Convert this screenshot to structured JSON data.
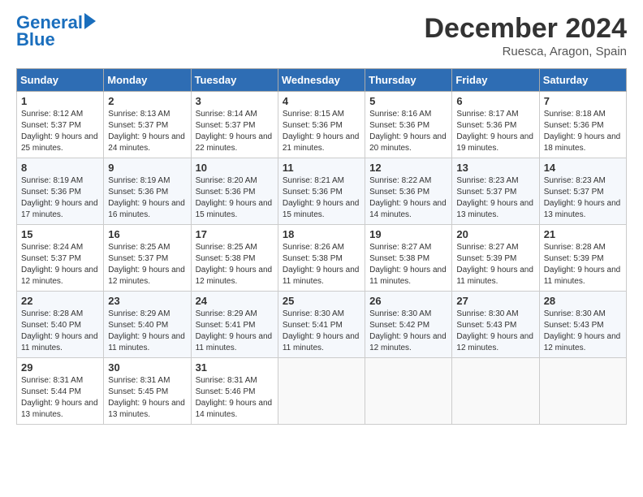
{
  "header": {
    "logo_line1": "General",
    "logo_line2": "Blue",
    "month": "December 2024",
    "location": "Ruesca, Aragon, Spain"
  },
  "weekdays": [
    "Sunday",
    "Monday",
    "Tuesday",
    "Wednesday",
    "Thursday",
    "Friday",
    "Saturday"
  ],
  "weeks": [
    [
      {
        "day": "1",
        "sunrise": "8:12 AM",
        "sunset": "5:37 PM",
        "daylight": "9 hours and 25 minutes."
      },
      {
        "day": "2",
        "sunrise": "8:13 AM",
        "sunset": "5:37 PM",
        "daylight": "9 hours and 24 minutes."
      },
      {
        "day": "3",
        "sunrise": "8:14 AM",
        "sunset": "5:37 PM",
        "daylight": "9 hours and 22 minutes."
      },
      {
        "day": "4",
        "sunrise": "8:15 AM",
        "sunset": "5:36 PM",
        "daylight": "9 hours and 21 minutes."
      },
      {
        "day": "5",
        "sunrise": "8:16 AM",
        "sunset": "5:36 PM",
        "daylight": "9 hours and 20 minutes."
      },
      {
        "day": "6",
        "sunrise": "8:17 AM",
        "sunset": "5:36 PM",
        "daylight": "9 hours and 19 minutes."
      },
      {
        "day": "7",
        "sunrise": "8:18 AM",
        "sunset": "5:36 PM",
        "daylight": "9 hours and 18 minutes."
      }
    ],
    [
      {
        "day": "8",
        "sunrise": "8:19 AM",
        "sunset": "5:36 PM",
        "daylight": "9 hours and 17 minutes."
      },
      {
        "day": "9",
        "sunrise": "8:19 AM",
        "sunset": "5:36 PM",
        "daylight": "9 hours and 16 minutes."
      },
      {
        "day": "10",
        "sunrise": "8:20 AM",
        "sunset": "5:36 PM",
        "daylight": "9 hours and 15 minutes."
      },
      {
        "day": "11",
        "sunrise": "8:21 AM",
        "sunset": "5:36 PM",
        "daylight": "9 hours and 15 minutes."
      },
      {
        "day": "12",
        "sunrise": "8:22 AM",
        "sunset": "5:36 PM",
        "daylight": "9 hours and 14 minutes."
      },
      {
        "day": "13",
        "sunrise": "8:23 AM",
        "sunset": "5:37 PM",
        "daylight": "9 hours and 13 minutes."
      },
      {
        "day": "14",
        "sunrise": "8:23 AM",
        "sunset": "5:37 PM",
        "daylight": "9 hours and 13 minutes."
      }
    ],
    [
      {
        "day": "15",
        "sunrise": "8:24 AM",
        "sunset": "5:37 PM",
        "daylight": "9 hours and 12 minutes."
      },
      {
        "day": "16",
        "sunrise": "8:25 AM",
        "sunset": "5:37 PM",
        "daylight": "9 hours and 12 minutes."
      },
      {
        "day": "17",
        "sunrise": "8:25 AM",
        "sunset": "5:38 PM",
        "daylight": "9 hours and 12 minutes."
      },
      {
        "day": "18",
        "sunrise": "8:26 AM",
        "sunset": "5:38 PM",
        "daylight": "9 hours and 11 minutes."
      },
      {
        "day": "19",
        "sunrise": "8:27 AM",
        "sunset": "5:38 PM",
        "daylight": "9 hours and 11 minutes."
      },
      {
        "day": "20",
        "sunrise": "8:27 AM",
        "sunset": "5:39 PM",
        "daylight": "9 hours and 11 minutes."
      },
      {
        "day": "21",
        "sunrise": "8:28 AM",
        "sunset": "5:39 PM",
        "daylight": "9 hours and 11 minutes."
      }
    ],
    [
      {
        "day": "22",
        "sunrise": "8:28 AM",
        "sunset": "5:40 PM",
        "daylight": "9 hours and 11 minutes."
      },
      {
        "day": "23",
        "sunrise": "8:29 AM",
        "sunset": "5:40 PM",
        "daylight": "9 hours and 11 minutes."
      },
      {
        "day": "24",
        "sunrise": "8:29 AM",
        "sunset": "5:41 PM",
        "daylight": "9 hours and 11 minutes."
      },
      {
        "day": "25",
        "sunrise": "8:30 AM",
        "sunset": "5:41 PM",
        "daylight": "9 hours and 11 minutes."
      },
      {
        "day": "26",
        "sunrise": "8:30 AM",
        "sunset": "5:42 PM",
        "daylight": "9 hours and 12 minutes."
      },
      {
        "day": "27",
        "sunrise": "8:30 AM",
        "sunset": "5:43 PM",
        "daylight": "9 hours and 12 minutes."
      },
      {
        "day": "28",
        "sunrise": "8:30 AM",
        "sunset": "5:43 PM",
        "daylight": "9 hours and 12 minutes."
      }
    ],
    [
      {
        "day": "29",
        "sunrise": "8:31 AM",
        "sunset": "5:44 PM",
        "daylight": "9 hours and 13 minutes."
      },
      {
        "day": "30",
        "sunrise": "8:31 AM",
        "sunset": "5:45 PM",
        "daylight": "9 hours and 13 minutes."
      },
      {
        "day": "31",
        "sunrise": "8:31 AM",
        "sunset": "5:46 PM",
        "daylight": "9 hours and 14 minutes."
      },
      null,
      null,
      null,
      null
    ]
  ]
}
